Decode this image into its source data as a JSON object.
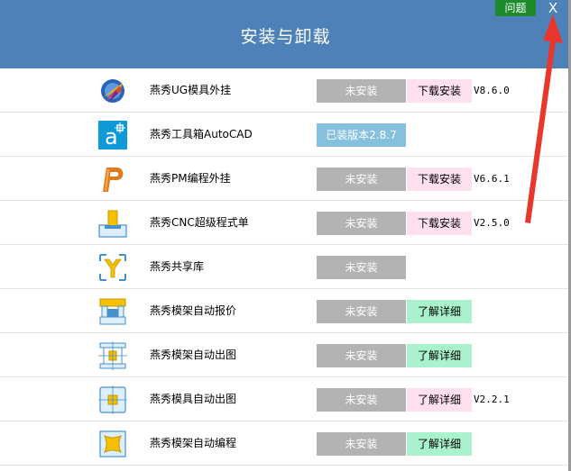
{
  "window": {
    "title": "安装与卸载",
    "help_label": "问题",
    "close_label": "X"
  },
  "items": [
    {
      "name": "燕秀UG模具外挂",
      "status": "未安装",
      "action": "下载安装",
      "action_type": "download",
      "version": "V8.6.0",
      "icon": "ug-nx-icon"
    },
    {
      "name": "燕秀工具箱AutoCAD",
      "status": "已装版本2.8.7",
      "status_type": "installed",
      "action": "",
      "action_type": "",
      "version": "",
      "icon": "autocad-icon"
    },
    {
      "name": "燕秀PM编程外挂",
      "status": "未安装",
      "action": "下载安装",
      "action_type": "download",
      "version": "V6.6.1",
      "icon": "powermill-icon"
    },
    {
      "name": "燕秀CNC超级程式单",
      "status": "未安装",
      "action": "下载安装",
      "action_type": "download",
      "version": "V2.5.0",
      "icon": "cnc-icon"
    },
    {
      "name": "燕秀共享库",
      "status": "未安装",
      "action": "",
      "action_type": "",
      "version": "",
      "icon": "shared-library-icon"
    },
    {
      "name": "燕秀模架自动报价",
      "status": "未安装",
      "action": "了解详细",
      "action_type": "detail",
      "version": "",
      "icon": "mold-frame-quote-icon"
    },
    {
      "name": "燕秀模架自动出图",
      "status": "未安装",
      "action": "了解详细",
      "action_type": "detail",
      "version": "",
      "icon": "mold-frame-drawing-icon"
    },
    {
      "name": "燕秀模具自动出图",
      "status": "未安装",
      "action": "了解详细",
      "action_type": "download",
      "version": "V2.2.1",
      "icon": "mold-drawing-icon"
    },
    {
      "name": "燕秀模架自动编程",
      "status": "未安装",
      "action": "了解详细",
      "action_type": "detail",
      "version": "",
      "icon": "mold-programming-icon"
    }
  ],
  "colors": {
    "header": "#4d81b8",
    "help": "#1d8a2c",
    "status_not_installed": "#b3b3b3",
    "status_installed": "#85c1df",
    "download": "#ffe0ee",
    "detail": "#a9f2cd",
    "annotation_arrow": "#e8372c"
  }
}
